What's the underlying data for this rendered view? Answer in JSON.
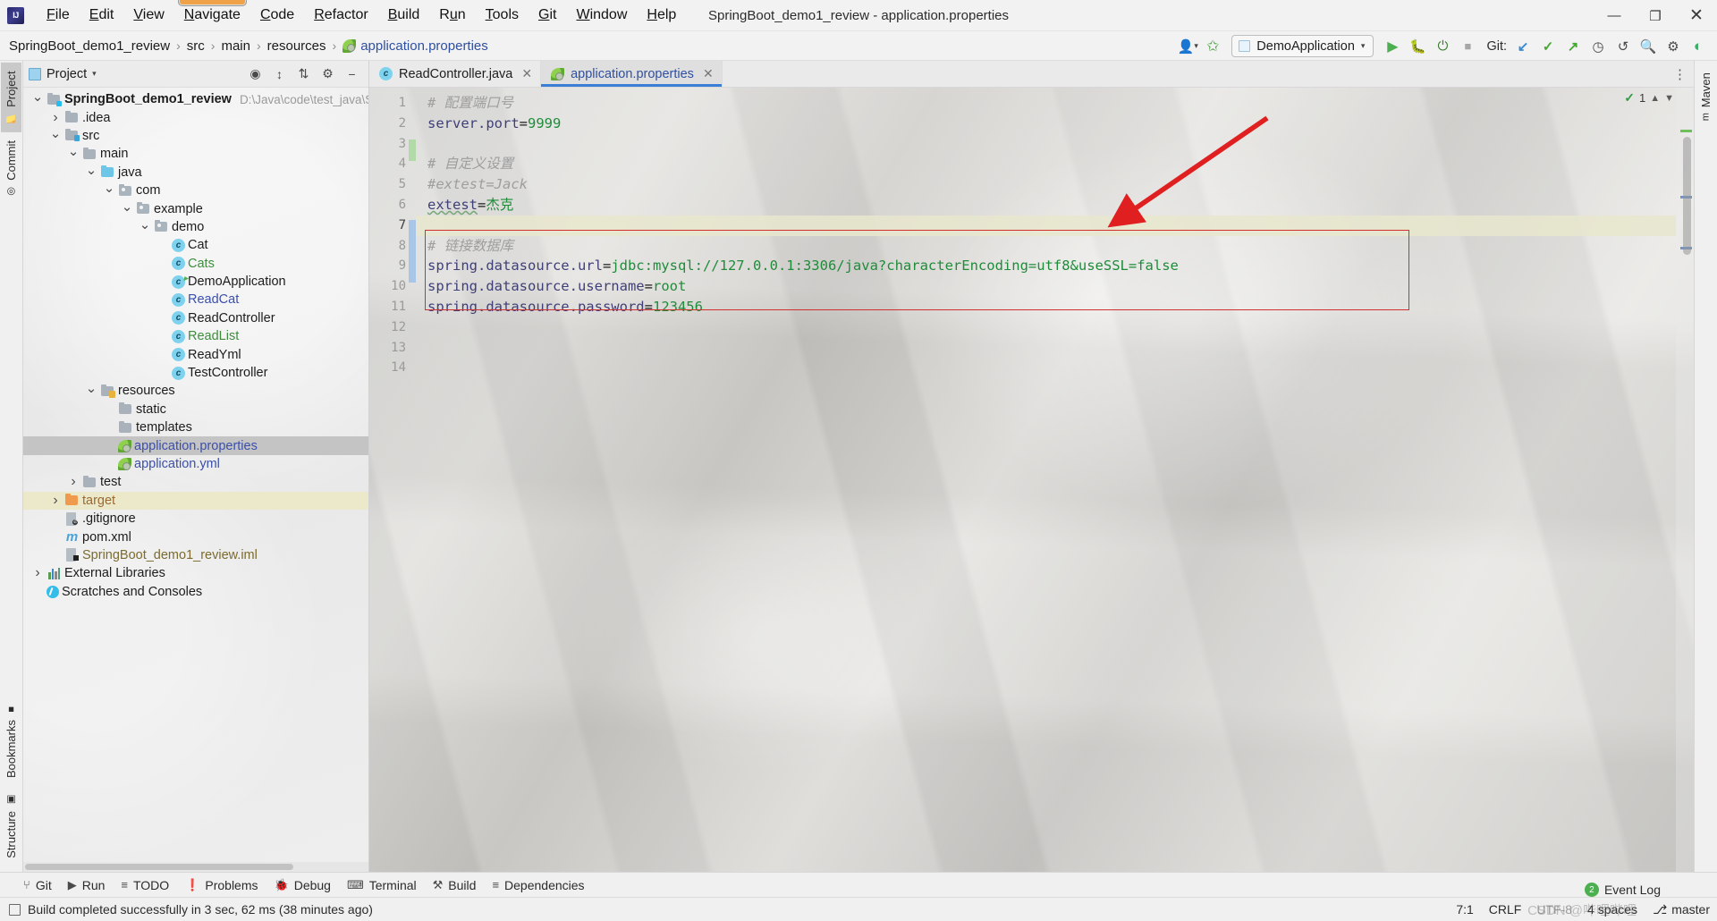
{
  "window": {
    "title": "SpringBoot_demo1_review - application.properties",
    "controls": {
      "minimize": "—",
      "maximize": "❐",
      "close": "✕"
    }
  },
  "menubar": {
    "items": [
      {
        "label": "File",
        "mnemonic": "F"
      },
      {
        "label": "Edit",
        "mnemonic": "E"
      },
      {
        "label": "View",
        "mnemonic": "V"
      },
      {
        "label": "Navigate",
        "mnemonic": "N"
      },
      {
        "label": "Code",
        "mnemonic": "C"
      },
      {
        "label": "Refactor",
        "mnemonic": "R"
      },
      {
        "label": "Build",
        "mnemonic": "B"
      },
      {
        "label": "Run",
        "mnemonic": "u"
      },
      {
        "label": "Tools",
        "mnemonic": "T"
      },
      {
        "label": "Git",
        "mnemonic": "G"
      },
      {
        "label": "Window",
        "mnemonic": "W"
      },
      {
        "label": "Help",
        "mnemonic": "H"
      }
    ]
  },
  "breadcrumb": {
    "items": [
      "SpringBoot_demo1_review",
      "src",
      "main",
      "resources",
      "application.properties"
    ],
    "separator": "›"
  },
  "toolbar": {
    "run_config": "DemoApplication",
    "git_label": "Git:",
    "icons": [
      "user-avatar-icon",
      "build-hammer-icon",
      "run-icon",
      "debug-icon",
      "run-with-coverage-icon",
      "stop-icon",
      "git-update-icon",
      "git-commit-icon",
      "git-push-icon",
      "history-icon",
      "undo-icon",
      "search-everywhere-icon",
      "settings-gear-icon",
      "ide-tips-icon"
    ]
  },
  "left_strip": {
    "tabs": [
      {
        "label": "Project",
        "icon": "project-folder-icon",
        "active": true
      },
      {
        "label": "Commit",
        "icon": "commit-icon",
        "active": false
      },
      {
        "label": "Structure",
        "icon": "structure-icon",
        "active": false
      },
      {
        "label": "Bookmarks",
        "icon": "bookmarks-icon",
        "active": false
      }
    ]
  },
  "right_strip": {
    "tabs": [
      {
        "label": "Maven",
        "icon": "maven-icon"
      }
    ]
  },
  "project_panel": {
    "title": "Project",
    "actions": [
      "target-icon",
      "expand-all-icon",
      "collapse-all-icon",
      "settings-gear-icon",
      "hide-icon"
    ],
    "tree": [
      {
        "label": "SpringBoot_demo1_review",
        "path": "D:\\Java\\code\\test_java\\SpringBo",
        "indent": 0,
        "chevron": "down",
        "icon": "module-folder-icon",
        "color": "dark",
        "bold": true
      },
      {
        "label": ".idea",
        "indent": 1,
        "chevron": "right",
        "icon": "folder-icon",
        "color": "dark"
      },
      {
        "label": "src",
        "indent": 1,
        "chevron": "down",
        "icon": "source-folder-icon",
        "color": "dark"
      },
      {
        "label": "main",
        "indent": 2,
        "chevron": "down",
        "icon": "folder-icon",
        "color": "dark"
      },
      {
        "label": "java",
        "indent": 3,
        "chevron": "down",
        "icon": "source-root-folder-icon",
        "color": "dark"
      },
      {
        "label": "com",
        "indent": 4,
        "chevron": "down",
        "icon": "package-icon",
        "color": "dark"
      },
      {
        "label": "example",
        "indent": 5,
        "chevron": "down",
        "icon": "package-icon",
        "color": "dark"
      },
      {
        "label": "demo",
        "indent": 6,
        "chevron": "down",
        "icon": "package-icon",
        "color": "dark"
      },
      {
        "label": "Cat",
        "indent": 7,
        "chevron": "none",
        "icon": "java-class-icon",
        "color": "dark"
      },
      {
        "label": "Cats",
        "indent": 7,
        "chevron": "none",
        "icon": "java-class-icon",
        "color": "green"
      },
      {
        "label": "DemoApplication",
        "indent": 7,
        "chevron": "none",
        "icon": "java-runnable-class-icon",
        "color": "dark"
      },
      {
        "label": "ReadCat",
        "indent": 7,
        "chevron": "none",
        "icon": "java-class-icon",
        "color": "blue"
      },
      {
        "label": "ReadController",
        "indent": 7,
        "chevron": "none",
        "icon": "java-class-icon",
        "color": "dark"
      },
      {
        "label": "ReadList",
        "indent": 7,
        "chevron": "none",
        "icon": "java-class-icon",
        "color": "green"
      },
      {
        "label": "ReadYml",
        "indent": 7,
        "chevron": "none",
        "icon": "java-class-icon",
        "color": "dark"
      },
      {
        "label": "TestController",
        "indent": 7,
        "chevron": "none",
        "icon": "java-class-icon",
        "color": "dark"
      },
      {
        "label": "resources",
        "indent": 3,
        "chevron": "down",
        "icon": "resources-folder-icon",
        "color": "dark"
      },
      {
        "label": "static",
        "indent": 4,
        "chevron": "none",
        "icon": "folder-icon",
        "color": "dark"
      },
      {
        "label": "templates",
        "indent": 4,
        "chevron": "none",
        "icon": "folder-icon",
        "color": "dark"
      },
      {
        "label": "application.properties",
        "indent": 4,
        "chevron": "none",
        "icon": "spring-leaf-icon",
        "color": "blue",
        "selected": true
      },
      {
        "label": "application.yml",
        "indent": 4,
        "chevron": "none",
        "icon": "spring-leaf-icon",
        "color": "blue"
      },
      {
        "label": "test",
        "indent": 2,
        "chevron": "right",
        "icon": "folder-icon",
        "color": "dark"
      },
      {
        "label": "target",
        "indent": 1,
        "chevron": "right",
        "icon": "excluded-folder-icon",
        "color": "orange",
        "highlight": true
      },
      {
        "label": ".gitignore",
        "indent": 1,
        "chevron": "none",
        "icon": "gitignore-file-icon",
        "color": "dark"
      },
      {
        "label": "pom.xml",
        "indent": 1,
        "chevron": "none",
        "icon": "maven-file-icon",
        "color": "dark"
      },
      {
        "label": "SpringBoot_demo1_review.iml",
        "indent": 1,
        "chevron": "none",
        "icon": "iml-file-icon",
        "color": "olive"
      },
      {
        "label": "External Libraries",
        "indent": 0,
        "chevron": "right",
        "icon": "libraries-icon",
        "color": "dark"
      },
      {
        "label": "Scratches and Consoles",
        "indent": 0,
        "chevron": "none",
        "icon": "scratches-icon",
        "color": "dark"
      }
    ]
  },
  "editor": {
    "tabs": [
      {
        "label": "ReadController.java",
        "icon": "java-class-icon",
        "active": false,
        "color": "dark"
      },
      {
        "label": "application.properties",
        "icon": "spring-leaf-icon",
        "active": true,
        "color": "blue"
      }
    ],
    "inspection": {
      "count": "1",
      "icon": "inspection-ok-icon"
    },
    "lines": [
      {
        "num": "1",
        "segments": [
          {
            "text": "# 配置端口号",
            "cls": "com"
          }
        ]
      },
      {
        "num": "2",
        "segments": [
          {
            "text": "server.port",
            "cls": "key"
          },
          {
            "text": "=",
            "cls": "eq"
          },
          {
            "text": "9999",
            "cls": "val"
          }
        ]
      },
      {
        "num": "3",
        "segments": []
      },
      {
        "num": "4",
        "segments": [
          {
            "text": "# 自定义设置",
            "cls": "com"
          }
        ]
      },
      {
        "num": "5",
        "segments": [
          {
            "text": "#extest=Jack",
            "cls": "com"
          }
        ]
      },
      {
        "num": "6",
        "segments": [
          {
            "text": "extest",
            "cls": "key wavy"
          },
          {
            "text": "=",
            "cls": "eq"
          },
          {
            "text": "杰克",
            "cls": "val"
          }
        ]
      },
      {
        "num": "7",
        "segments": [],
        "caret": true
      },
      {
        "num": "8",
        "segments": [
          {
            "text": "# 链接数据库",
            "cls": "com"
          }
        ]
      },
      {
        "num": "9",
        "segments": [
          {
            "text": "spring.datasource.url",
            "cls": "key"
          },
          {
            "text": "=",
            "cls": "eq"
          },
          {
            "text": "jdbc:mysql://127.0.0.1:3306/java?characterEncoding=utf8&useSSL=false",
            "cls": "val"
          }
        ]
      },
      {
        "num": "10",
        "segments": [
          {
            "text": "spring.datasource.username",
            "cls": "key"
          },
          {
            "text": "=",
            "cls": "eq"
          },
          {
            "text": "root",
            "cls": "val"
          }
        ]
      },
      {
        "num": "11",
        "segments": [
          {
            "text": "spring.datasource.password",
            "cls": "key"
          },
          {
            "text": "=",
            "cls": "eq"
          },
          {
            "text": "123456",
            "cls": "val"
          }
        ]
      },
      {
        "num": "12",
        "segments": []
      },
      {
        "num": "13",
        "segments": []
      },
      {
        "num": "14",
        "segments": []
      }
    ],
    "annotation": {
      "type": "red-rectangle-highlight",
      "arrow": "red-arrow-pointer",
      "color": "#d32f2f"
    }
  },
  "bottom_tabs": [
    {
      "label": "Git",
      "icon": "git-branch-icon"
    },
    {
      "label": "Run",
      "icon": "run-icon"
    },
    {
      "label": "TODO",
      "icon": "todo-list-icon"
    },
    {
      "label": "Problems",
      "icon": "problems-icon"
    },
    {
      "label": "Debug",
      "icon": "debug-bug-icon"
    },
    {
      "label": "Terminal",
      "icon": "terminal-icon"
    },
    {
      "label": "Build",
      "icon": "build-hammer-icon"
    },
    {
      "label": "Dependencies",
      "icon": "dependencies-icon"
    }
  ],
  "statusbar": {
    "message": "Build completed successfully in 3 sec, 62 ms (38 minutes ago)",
    "message_icon": "build-status-icon",
    "caret_position": "7:1",
    "line_separator": "CRLF",
    "encoding": "UTF-8",
    "indent": "4 spaces",
    "branch": "master",
    "branch_icon": "git-branch-icon",
    "event_log": {
      "label": "Event Log",
      "count": "2"
    },
    "watermark": "CSDN @哔哩哔哩"
  },
  "colors": {
    "accent_blue": "#3a7fd5",
    "annotation_red": "#d32f2f",
    "value_green": "#1f8c3a",
    "key_purple": "#3f3f78",
    "comment_gray": "#9e9e9e",
    "selection_gray": "#c4c4c4",
    "caret_line": "#e8e6cd"
  }
}
